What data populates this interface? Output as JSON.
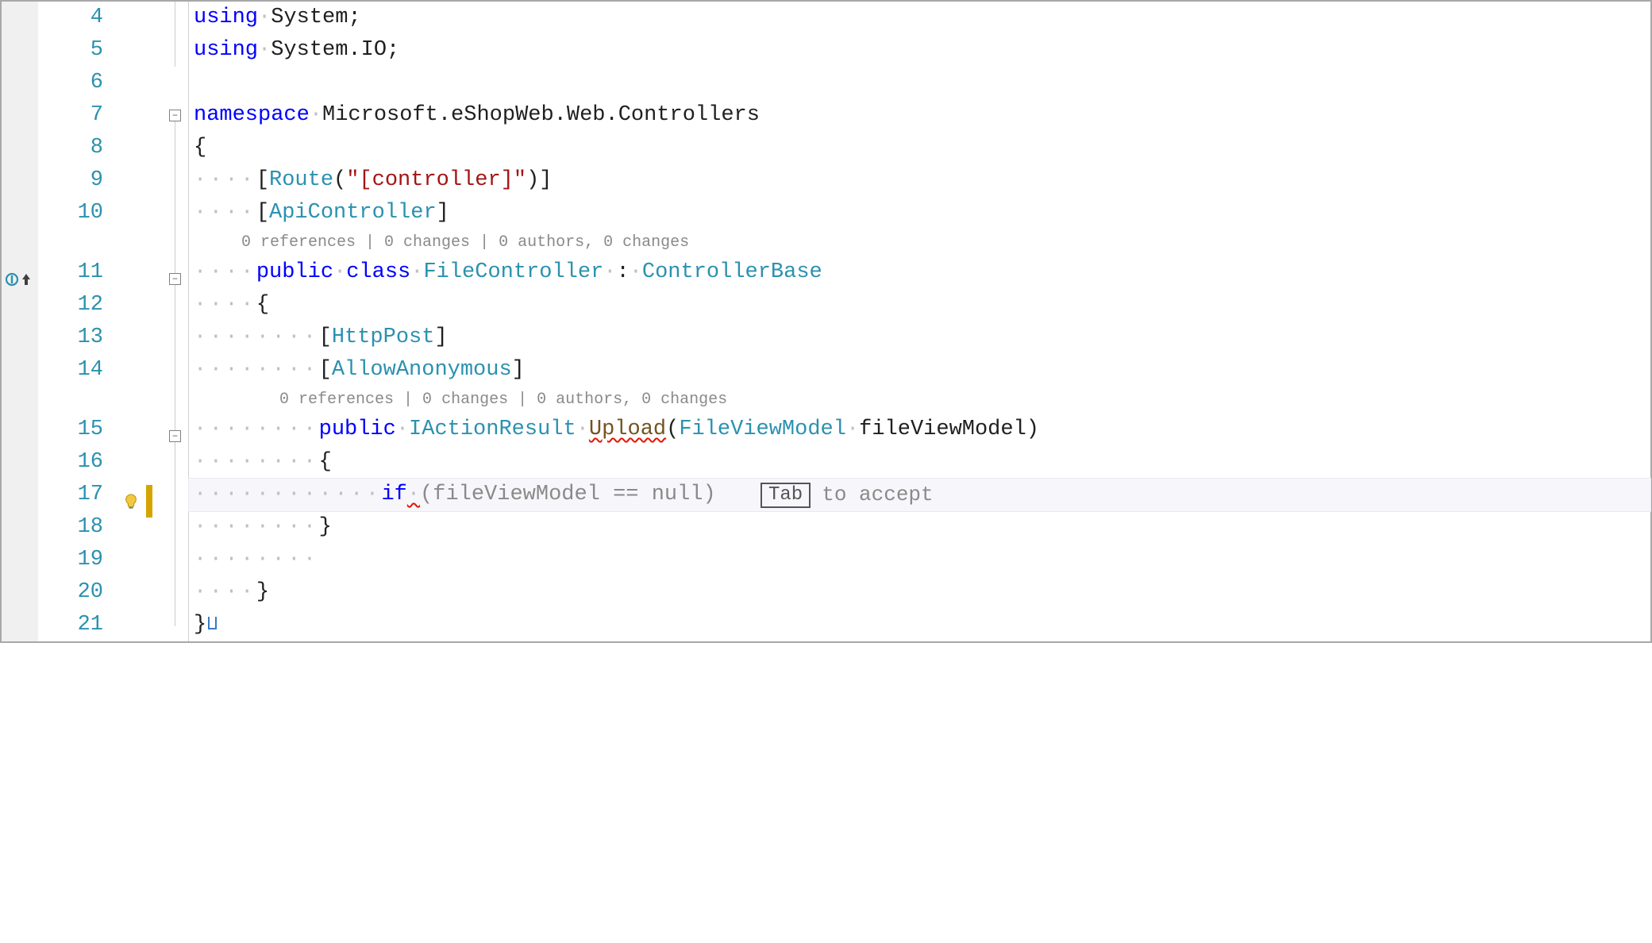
{
  "lineNumbers": [
    "4",
    "5",
    "6",
    "7",
    "8",
    "9",
    "10",
    "11",
    "12",
    "13",
    "14",
    "15",
    "16",
    "17",
    "18",
    "19",
    "20",
    "21"
  ],
  "codelens1": "0 references | 0 changes | 0 authors, 0 changes",
  "codelens2": "0 references | 0 changes | 0 authors, 0 changes",
  "autocomplete": {
    "key": "Tab",
    "hint": "to accept"
  },
  "tokens": {
    "using": "using",
    "system": "System",
    "systemIO": "System.IO",
    "namespace": "namespace",
    "nsName": "Microsoft.eShopWeb.Web.Controllers",
    "route": "Route",
    "routeArg": "\"[controller]\"",
    "apiController": "ApiController",
    "public": "public",
    "class": "class",
    "fileController": "FileController",
    "controllerBase": "ControllerBase",
    "httpPost": "HttpPost",
    "allowAnonymous": "AllowAnonymous",
    "iactionResult": "IActionResult",
    "upload": "Upload",
    "fileViewModelType": "FileViewModel",
    "fileViewModelParam": "fileViewModel",
    "if": "if",
    "ghostCond": "(fileViewModel == null)",
    "dot": "·",
    "semi": ";",
    "comma": ",",
    "colon": ":",
    "lparen": "(",
    "rparen": ")",
    "lbrack": "[",
    "rbrack": "]",
    "lbrace": "{",
    "rbrace": "}"
  }
}
